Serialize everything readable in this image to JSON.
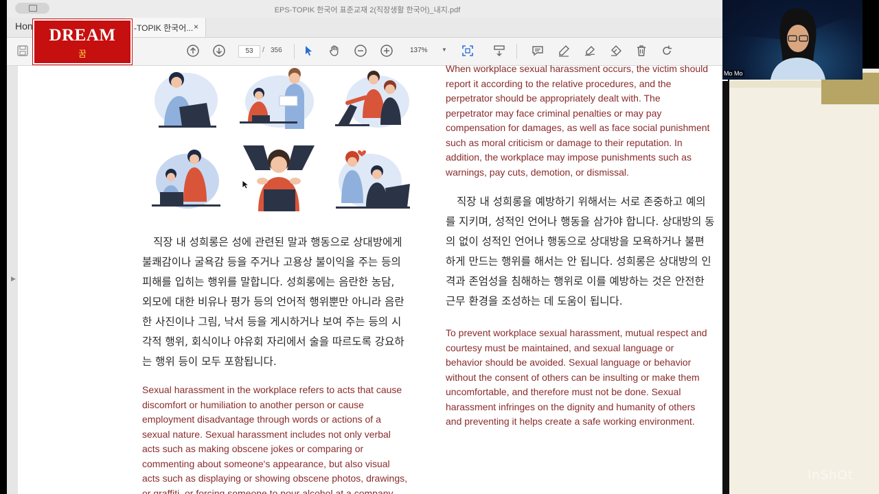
{
  "window": {
    "title": "EPS-TOPIK 한국어 표준교재 2(직장생활 한국어)_내지.pdf"
  },
  "tabs": {
    "home": "Hon",
    "document": "-TOPIK 한국어...",
    "close": "×"
  },
  "toolbar": {
    "page_current": "53",
    "page_separator": "/",
    "page_total": "356",
    "zoom": "137%",
    "zoom_caret": "▼",
    "icons": [
      "save-icon",
      "page-up-icon",
      "page-down-icon",
      "select-pointer-icon",
      "hand-tool-icon",
      "zoom-out-icon",
      "zoom-in-icon",
      "fit-page-icon",
      "scroll-mode-icon",
      "comment-icon",
      "highlight-pen-icon",
      "sign-icon",
      "redact-icon",
      "delete-icon",
      "rotate-icon"
    ]
  },
  "logo": {
    "title": "DREAM",
    "subtitle": "꿈"
  },
  "webcam": {
    "name": "Mo Mo"
  },
  "document": {
    "left_korean": [
      "직장 내 성희롱은 성에 관련된 말과 행동으로 상대방에게",
      "불쾌감이나 굴욕감 등을 주거나 고용상 불이익을 주는 등의",
      "피해를 입히는 행위를 말합니다. 성희롱에는 음란한 농담,",
      "외모에 대한 비유나 평가 등의 언어적 행위뿐만 아니라 음란",
      "한 사진이나 그림, 낙서 등을 게시하거나 보여 주는 등의 시",
      "각적 행위, 회식이나 야유회 자리에서 술을 따르도록 강요하",
      "는 행위 등이 모두 포함됩니다."
    ],
    "left_english": [
      "Sexual harassment in the workplace refers to acts that cause",
      "discomfort or humiliation to another person or cause",
      "employment disadvantage through words or actions of a",
      "sexual nature. Sexual harassment includes not only verbal",
      "acts such as making obscene jokes or comparing or",
      "commenting about someone's appearance, but also visual",
      "acts such as displaying or showing obscene photos, drawings,",
      "or graffiti, or forcing someone to pour alcohol at a company"
    ],
    "right_english_top": [
      "When workplace sexual harassment occurs, the victim should",
      "report it according to the relative procedures, and the",
      "perpetrator should be appropriately dealt with. The",
      "perpetrator may face criminal penalties or may pay",
      "compensation for damages, as well as face social punishment",
      "such as moral criticism or damage to their reputation. In",
      "addition, the workplace may impose punishments such as",
      "warnings, pay cuts, demotion, or dismissal."
    ],
    "right_korean": [
      "직장 내 성희롱을 예방하기 위해서는 서로 존중하고 예의",
      "를 지키며, 성적인 언어나 행동을 삼가야 합니다. 상대방의 동",
      "의 없이 성적인 언어나 행동으로 상대방을 모욕하거나 불편",
      "하게 만드는 행위를 해서는 안 됩니다. 성희롱은 상대방의 인",
      "격과 존엄성을 침해하는 행위로 이를 예방하는 것은 안전한",
      "근무 환경을 조성하는 데 도움이 됩니다."
    ],
    "right_english_bottom": [
      "To prevent workplace sexual harassment, mutual respect and",
      "courtesy must be maintained, and sexual language or",
      "behavior should be avoided. Sexual language or behavior",
      "without the consent of others can be insulting or make them",
      "uncomfortable, and therefore must not be done. Sexual",
      "harassment infringes on the dignity and humanity of others",
      "and preventing it helps create a safe working environment."
    ]
  },
  "watermark": "InShOt",
  "colors": {
    "logo_red": "#c60f0f",
    "english_text": "#8a2b2b",
    "illustration_blue": "#8fb0dc",
    "illustration_red": "#d8553a"
  }
}
